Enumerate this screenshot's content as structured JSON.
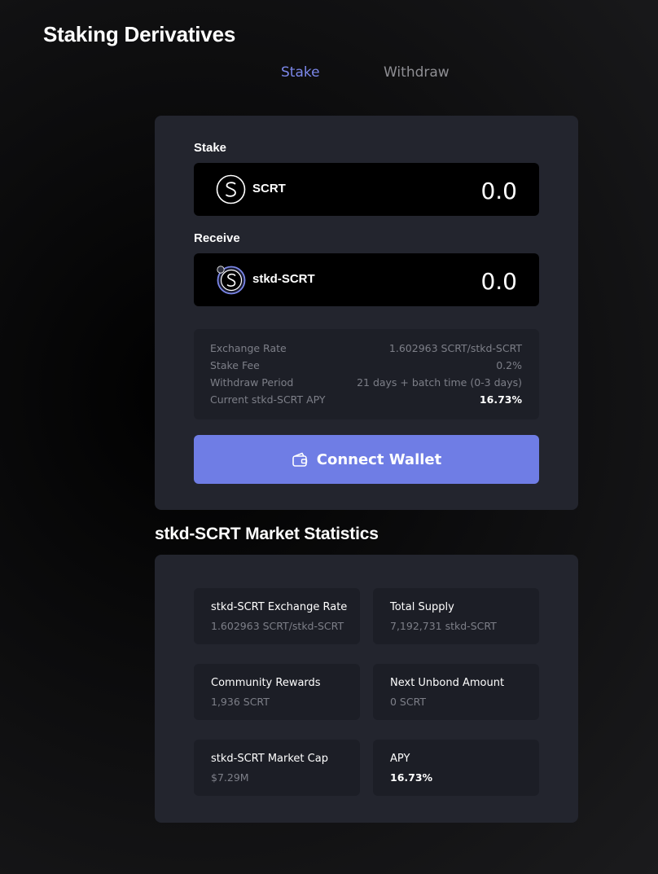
{
  "page": {
    "title": "Staking Derivatives"
  },
  "tabs": [
    {
      "label": "Stake",
      "active": true
    },
    {
      "label": "Withdraw",
      "active": false
    }
  ],
  "stake": {
    "stake_label": "Stake",
    "stake_token": {
      "name": "SCRT",
      "amount": "0.0",
      "icon": "scrt-logo-icon"
    },
    "receive_label": "Receive",
    "receive_token": {
      "name": "stkd-SCRT",
      "amount": "0.0",
      "icon": "stkd-scrt-logo-icon"
    },
    "info": [
      {
        "key": "Exchange Rate",
        "value": "1.602963 SCRT/stkd-SCRT"
      },
      {
        "key": "Stake Fee",
        "value": "0.2%"
      },
      {
        "key": "Withdraw Period",
        "value": "21 days + batch time (0-3 days)"
      },
      {
        "key": "Current stkd-SCRT APY",
        "value": "16.73%"
      }
    ],
    "connect_button": {
      "label": "Connect Wallet",
      "icon": "wallet-icon",
      "color": "#6f7de5"
    }
  },
  "stats": {
    "title": "stkd-SCRT Market Statistics",
    "tiles": [
      {
        "title": "stkd-SCRT Exchange Rate",
        "value": "1.602963 SCRT/stkd-SCRT"
      },
      {
        "title": "Total Supply",
        "value": "7,192,731 stkd-SCRT"
      },
      {
        "title": "Community Rewards",
        "value": "1,936 SCRT"
      },
      {
        "title": "Next Unbond Amount",
        "value": "0 SCRT"
      },
      {
        "title": "stkd-SCRT Market Cap",
        "value": "$7.29M"
      },
      {
        "title": "APY",
        "value": "16.73%"
      }
    ]
  },
  "colors": {
    "accent": "#7b87e9",
    "card": "#23252e",
    "muted_text": "#7d7f88"
  }
}
